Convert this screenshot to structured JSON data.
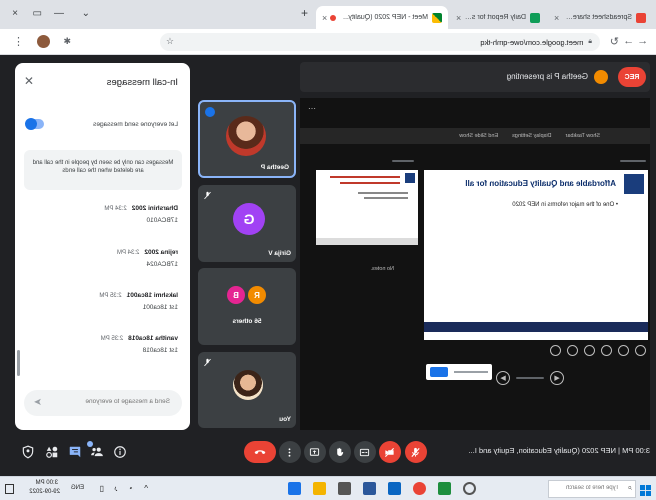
{
  "browser": {
    "tabs": [
      {
        "title": "Spreadsheet shared with you",
        "icon": "gmail-icon"
      },
      {
        "title": "Daily Report for self-study",
        "icon": "sheets-icon"
      },
      {
        "title": "Meet - NEP 2020 (Quality...",
        "icon": "meet-icon",
        "active": true,
        "recording": true
      }
    ],
    "url": "meet.google.com/owe-qmh-tkq"
  },
  "meet": {
    "recording_badge": "REC",
    "presenting": "Geetha P is presenting",
    "tiles": [
      {
        "name": "Geetha P",
        "speaking": true,
        "pinned": true
      },
      {
        "name": "Girija V",
        "initial": "G",
        "color": "#a142f4"
      },
      {
        "name": "56 others",
        "avatars": [
          {
            "initial": "R",
            "color": "#f28b00"
          },
          {
            "initial": "B",
            "color": "#e52592"
          }
        ]
      },
      {
        "name": "You"
      }
    ],
    "meeting_details": "3:00 PM | NEP 2020 (Quality Education, Equity and I...",
    "controls": [
      "mic-off",
      "camera-off",
      "captions",
      "raise-hand",
      "present",
      "more-options",
      "leave-call"
    ],
    "side_buttons": [
      "info",
      "people",
      "chat",
      "activities",
      "host-controls"
    ],
    "active_side_button": "chat"
  },
  "presentation": {
    "toolbar": [
      "Show Taskbar",
      "Display Settings",
      "End Slide Show"
    ],
    "slide_title": "Affordable and Quality Education for all",
    "slide_bullet": "One of the major reforms in NEP 2020",
    "notes": "No notes."
  },
  "chat": {
    "title": "In-call messages",
    "toggle_label": "Let everyone send messages",
    "toggle_on": true,
    "notice": "Messages can only be seen by people in the call and are deleted when the call ends",
    "messages": [
      {
        "sender": "Dharshini 2002",
        "time": "2:34 PM",
        "text": "17BCA010"
      },
      {
        "sender": "rejina 2002",
        "time": "2:34 PM",
        "text": "17BCA024"
      },
      {
        "sender": "lakshmi 18ca001",
        "time": "2:35 PM",
        "text": "1st 18ca001"
      },
      {
        "sender": "vanitha 18ca018",
        "time": "2:35 PM",
        "text": "1st 18ca018"
      }
    ],
    "input_placeholder": "Send a message to everyone"
  },
  "taskbar": {
    "search_placeholder": "Type here to search",
    "language": "ENG",
    "time": "3:00 PM",
    "date": "29-09-2022"
  },
  "colors": {
    "meet_bg": "#202124",
    "accent": "#1a73e8",
    "danger": "#ea4335"
  }
}
